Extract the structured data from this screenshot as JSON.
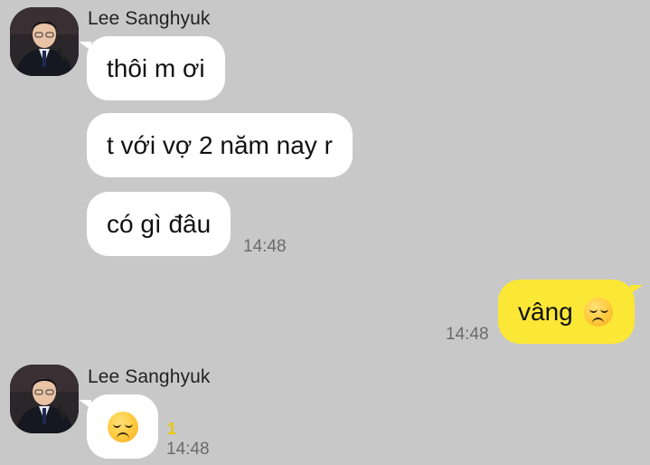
{
  "chat": {
    "messages": [
      {
        "sender": "Lee Sanghyuk",
        "direction": "incoming",
        "bubbles": [
          "thôi m ơi",
          "t với vợ 2 năm nay r",
          "có gì đâu"
        ],
        "time": "14:48"
      },
      {
        "direction": "outgoing",
        "text": "vâng",
        "emoji": "disappointed-face",
        "time": "14:48"
      },
      {
        "sender": "Lee Sanghyuk",
        "direction": "incoming",
        "emoji": "disappointed-face",
        "unread": "1",
        "time": "14:48"
      }
    ]
  },
  "colors": {
    "background": "#c8c8c8",
    "incoming_bubble": "#ffffff",
    "outgoing_bubble": "#fbe735",
    "unread_count": "#e8c800",
    "time_text": "#6b6b6b"
  }
}
